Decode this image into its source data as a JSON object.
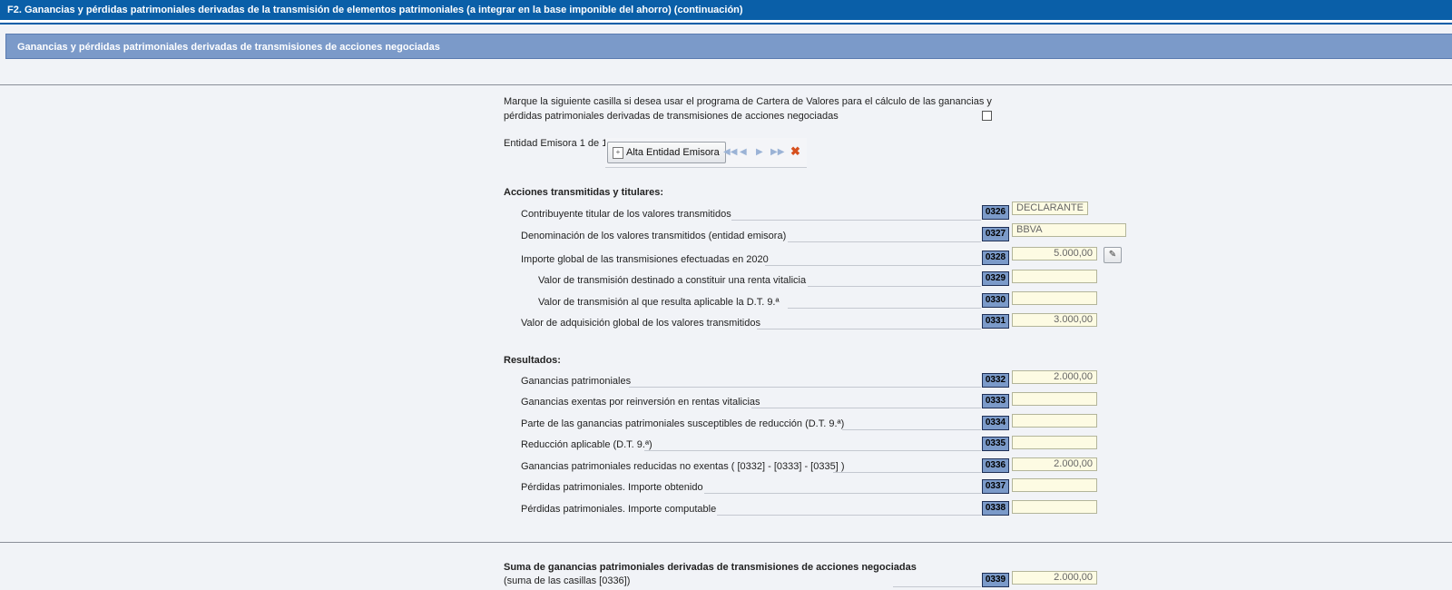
{
  "header": {
    "title": "F2.  Ganancias y pérdidas patrimoniales derivadas de la transmisión de elementos patrimoniales (a integrar en la base imponible del ahorro) (continuación)"
  },
  "section": {
    "title": "Ganancias y pérdidas patrimoniales derivadas de transmisiones de acciones negociadas"
  },
  "cartera": {
    "line1": "Marque la siguiente casilla si desea usar el programa de Cartera de Valores para el cálculo de las ganancias y",
    "line2": "pérdidas patrimoniales derivadas de transmisiones de acciones negociadas",
    "checked": false
  },
  "entidad": {
    "label": "Entidad Emisora 1 de 1",
    "alta_button": "Alta Entidad Emisora",
    "icons": [
      "first-icon",
      "prev-icon",
      "next-icon",
      "last-icon",
      "delete-icon"
    ]
  },
  "acciones": {
    "heading": "Acciones transmitidas y titulares:",
    "rows": [
      {
        "label": "Contribuyente titular de los valores transmitidos",
        "code": "0326",
        "value": "DECLARANTE"
      },
      {
        "label": "Denominación de los valores transmitidos (entidad emisora)",
        "code": "0327",
        "value": "BBVA"
      },
      {
        "label": "Importe global de las transmisiones efectuadas en 2020",
        "code": "0328",
        "value": "5.000,00"
      },
      {
        "label": "Valor de transmisión destinado a constituir una renta vitalicia",
        "code": "0329",
        "value": ""
      },
      {
        "label": "Valor de transmisión al que resulta aplicable la D.T. 9.ª",
        "code": "0330",
        "value": ""
      },
      {
        "label": "Valor de adquisición global de los valores transmitidos",
        "code": "0331",
        "value": "3.000,00"
      }
    ]
  },
  "resultados": {
    "heading": "Resultados:",
    "rows": [
      {
        "label": "Ganancias patrimoniales",
        "code": "0332",
        "value": "2.000,00"
      },
      {
        "label": "Ganancias exentas por reinversión en rentas vitalicias",
        "code": "0333",
        "value": ""
      },
      {
        "label": "Parte de las ganancias patrimoniales susceptibles de reducción (D.T. 9.ª)",
        "code": "0334",
        "value": ""
      },
      {
        "label": "Reducción aplicable (D.T. 9.ª)",
        "code": "0335",
        "value": ""
      },
      {
        "label": "Ganancias patrimoniales reducidas no exentas ( [0332] - [0333] - [0335] )",
        "code": "0336",
        "value": "2.000,00"
      },
      {
        "label": "Pérdidas patrimoniales. Importe obtenido",
        "code": "0337",
        "value": ""
      },
      {
        "label": "Pérdidas patrimoniales. Importe computable",
        "code": "0338",
        "value": ""
      }
    ]
  },
  "suma": {
    "title": "Suma de ganancias patrimoniales derivadas de transmisiones de acciones negociadas",
    "subtitle": "(suma de las casillas [0336])",
    "code": "0339",
    "value": "2.000,00"
  }
}
